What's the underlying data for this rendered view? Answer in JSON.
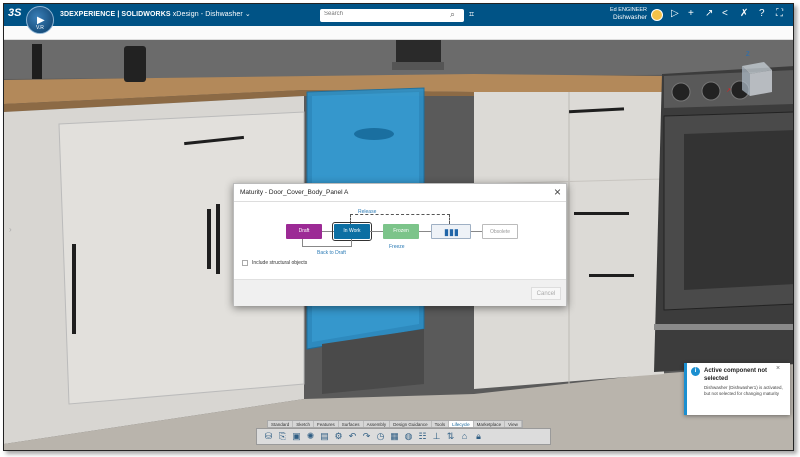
{
  "topbar": {
    "logo": "3S",
    "compass_version": "V.R",
    "app_title_brand": "3DEXPERIENCE | SOLIDWORKS",
    "app_title_rest": " xDesign - Dishwasher",
    "chevron": "⌄",
    "search_placeholder": "Search",
    "user_name": "Ed ENGINEER",
    "user_context": "Dishwasher",
    "icons": [
      "tag-icon",
      "share-icon",
      "plus-icon",
      "arrow-icon",
      "share-alt-icon",
      "tools-icon",
      "help-icon",
      "fullscreen-icon"
    ]
  },
  "modal": {
    "title": "Maturity - Door_Cover_Body_Panel A",
    "states": {
      "draft": "Draft",
      "in_work": "In Work",
      "frozen": "Frozen",
      "obsolete": "Obsolete"
    },
    "transitions": {
      "release": "Release",
      "back_to_draft": "Back to Draft",
      "freeze": "Freeze"
    },
    "include_label": "Include structural objects",
    "cancel_label": "Cancel"
  },
  "notification": {
    "title": "Active component not selected",
    "body": "Dishwasher (Dishwasher1) is activated, but not selected for changing maturity"
  },
  "action_bar": {
    "tabs": [
      "Standard",
      "Sketch",
      "Features",
      "Surfaces",
      "Assembly",
      "Design Guidance",
      "Tools",
      "Lifecycle",
      "Marketplace",
      "View"
    ],
    "active_tab": "Lifecycle"
  },
  "colors": {
    "topbar": "#005386",
    "draft": "#9c2a95",
    "in_work": "#0c6fa3",
    "frozen": "#7cc48a",
    "dishwasher_door": "#2b8fc7"
  }
}
